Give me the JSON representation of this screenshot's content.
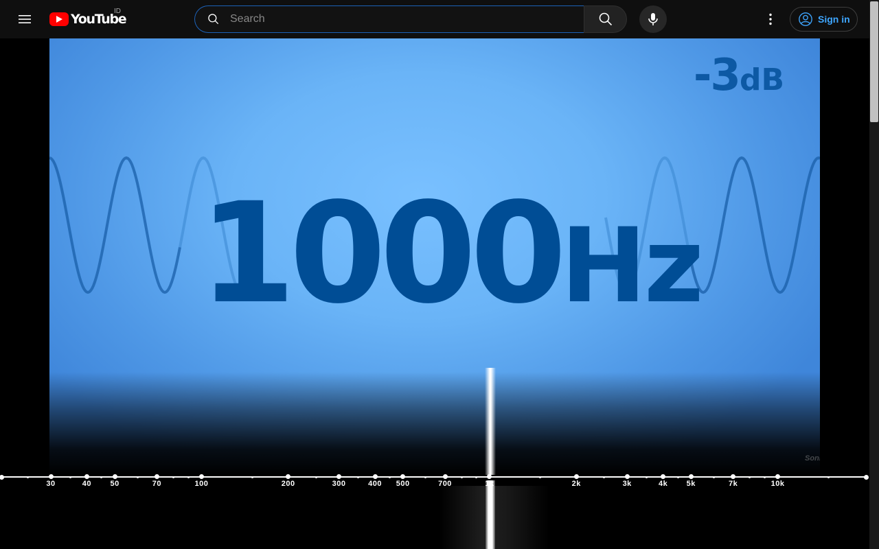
{
  "masthead": {
    "logo_text": "YouTube",
    "country_code": "ID",
    "search_placeholder": "Search",
    "signin_label": "Sign in"
  },
  "video": {
    "frequency_value": "1000",
    "frequency_unit": "Hz",
    "level_value": "-3",
    "level_unit": "dB",
    "watermark": "Sonic"
  },
  "spectrum": {
    "tick_labels": [
      {
        "label": "30",
        "freq": 30
      },
      {
        "label": "40",
        "freq": 40
      },
      {
        "label": "50",
        "freq": 50
      },
      {
        "label": "70",
        "freq": 70
      },
      {
        "label": "100",
        "freq": 100
      },
      {
        "label": "200",
        "freq": 200
      },
      {
        "label": "300",
        "freq": 300
      },
      {
        "label": "400",
        "freq": 400
      },
      {
        "label": "500",
        "freq": 500
      },
      {
        "label": "700",
        "freq": 700
      },
      {
        "label": "1k",
        "freq": 1000
      },
      {
        "label": "2k",
        "freq": 2000
      },
      {
        "label": "3k",
        "freq": 3000
      },
      {
        "label": "4k",
        "freq": 4000
      },
      {
        "label": "5k",
        "freq": 5000
      },
      {
        "label": "7k",
        "freq": 7000
      },
      {
        "label": "10k",
        "freq": 10000
      }
    ],
    "minor_freqs": [
      20,
      25,
      35,
      45,
      60,
      80,
      90,
      150,
      250,
      350,
      450,
      600,
      800,
      900,
      1500,
      2500,
      3500,
      4500,
      6000,
      8000,
      9000,
      15000,
      20000
    ]
  }
}
